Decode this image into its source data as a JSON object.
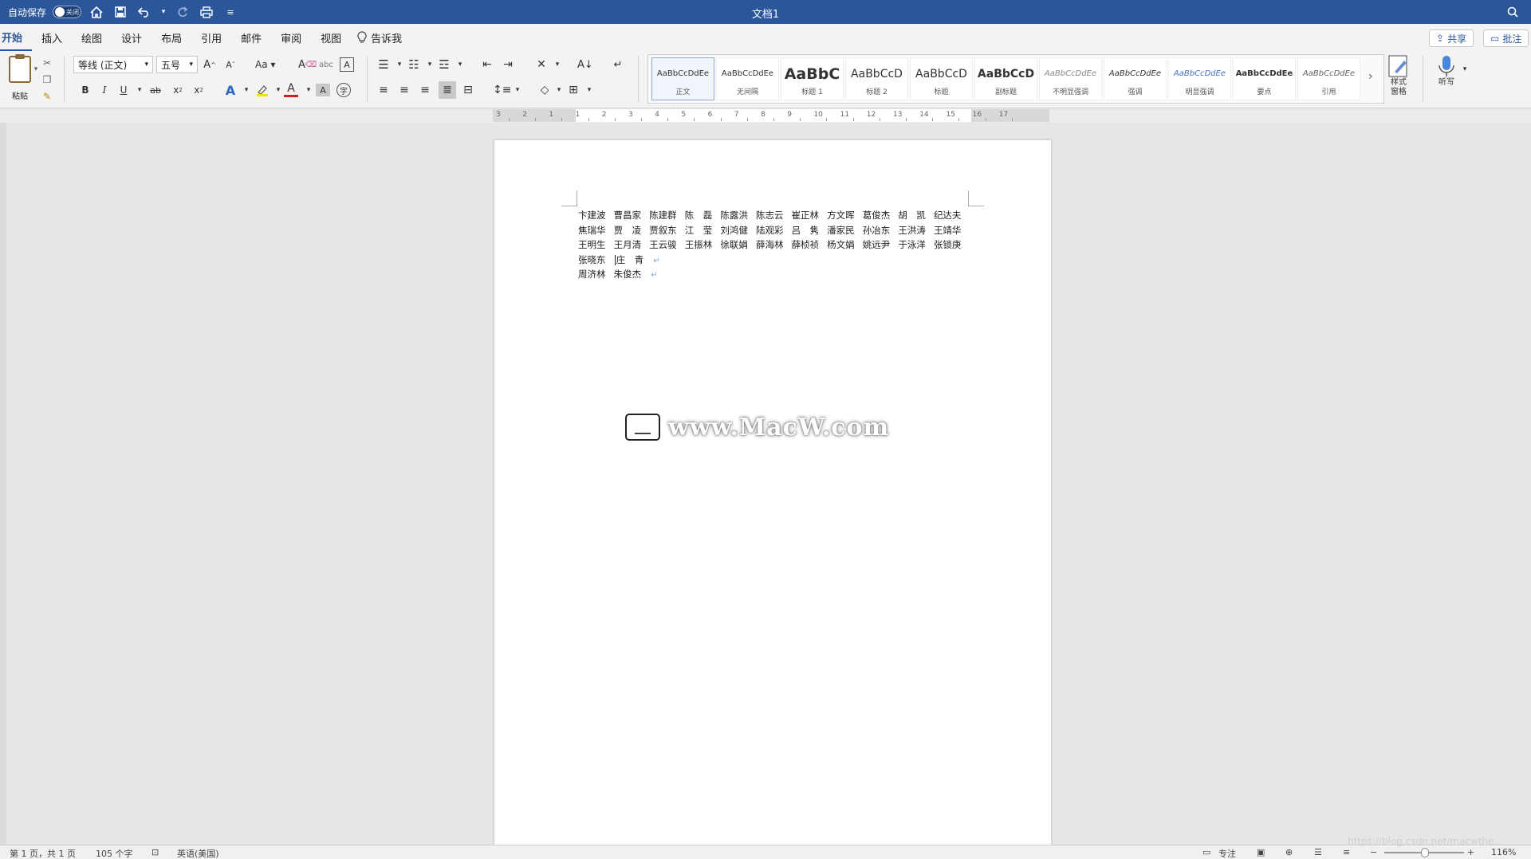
{
  "titlebar": {
    "autosave_label": "自动保存",
    "autosave_state": "关闭",
    "doc_title": "文档1",
    "icons": [
      "home-icon",
      "save-icon",
      "undo-icon",
      "redo-icon",
      "print-icon",
      "customize-icon"
    ]
  },
  "tabs": [
    "开始",
    "插入",
    "绘图",
    "设计",
    "布局",
    "引用",
    "邮件",
    "审阅",
    "视图"
  ],
  "tell_me": "告诉我",
  "share_label": "共享",
  "comments_label": "批注",
  "ribbon": {
    "paste_label": "粘贴",
    "font_name": "等线 (正文)",
    "font_size": "五号",
    "styles": [
      {
        "sample": "AaBbCcDdEe",
        "name": "正文"
      },
      {
        "sample": "AaBbCcDdEe",
        "name": "无间隔"
      },
      {
        "sample": "AaBbC",
        "name": "标题 1"
      },
      {
        "sample": "AaBbCcD",
        "name": "标题 2"
      },
      {
        "sample": "AaBbCcD",
        "name": "标题"
      },
      {
        "sample": "AaBbCcD",
        "name": "副标题"
      },
      {
        "sample": "AaBbCcDdEe",
        "name": "不明显强调"
      },
      {
        "sample": "AaBbCcDdEe",
        "name": "强调"
      },
      {
        "sample": "AaBbCcDdEe",
        "name": "明显强调"
      },
      {
        "sample": "AaBbCcDdEe",
        "name": "要点"
      },
      {
        "sample": "AaBbCcDdEe",
        "name": "引用"
      }
    ],
    "styles_pane_label": "样式\n窗格",
    "dictate_label": "听写"
  },
  "ruler_numbers": [
    "3",
    "2",
    "1",
    "1",
    "2",
    "3",
    "4",
    "5",
    "6",
    "7",
    "8",
    "9",
    "10",
    "11",
    "12",
    "13",
    "14",
    "15",
    "16",
    "17"
  ],
  "document": {
    "lines": [
      [
        "卞建波",
        "曹昌家",
        "陈建群",
        "陈　磊",
        "陈露洪",
        "陈志云",
        "崔正林",
        "方文晖",
        "葛俊杰",
        "胡　凯",
        "纪达夫"
      ],
      [
        "焦瑞华",
        "贾　凌",
        "贾叙东",
        "江　莹",
        "刘鸿健",
        "陆观彩",
        "吕　隽",
        "潘家民",
        "孙冶东",
        "王洪涛",
        "王靖华"
      ],
      [
        "王明生",
        "王月清",
        "王云骏",
        "王振林",
        "徐联娟",
        "薛海林",
        "薛桢祯",
        "杨文娟",
        "姚远尹",
        "于泳洋",
        "张锁庚"
      ],
      [
        "张晓东",
        "庄　青"
      ],
      [
        "周济林",
        "朱俊杰"
      ]
    ],
    "watermark": "www.MacW.com"
  },
  "statusbar": {
    "page": "第 1 页，共 1 页",
    "words": "105 个字",
    "language": "英语(美国)",
    "focus": "专注",
    "zoom": "116%",
    "overlay_url": "https://blog.csdn.net/macwthe..."
  }
}
